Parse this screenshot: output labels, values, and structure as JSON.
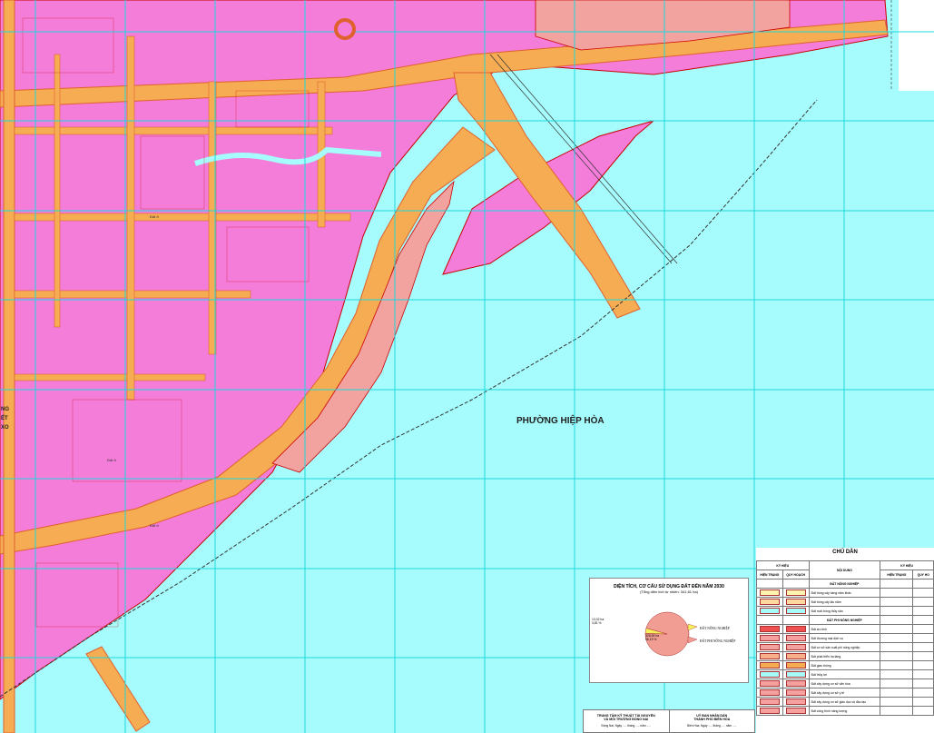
{
  "ward_label": "PHƯỜNG HIỆP HÒA",
  "edge_label_lines": [
    "NG",
    "ẾT",
    "XO"
  ],
  "block_labels": [
    "Đất ở",
    "Đất ở",
    "Đất ở"
  ],
  "colors": {
    "water": "#a6fcfc",
    "residential": "#f37dd9",
    "road": "#f6ac53",
    "road_edge": "#e0612d",
    "public": "#f2a3a0",
    "grid": "#1fd7de",
    "boundary": "#cc0000"
  },
  "pie": {
    "title": "DIỆN TÍCH, CƠ CẤU SỬ DỤNG ĐẤT ĐẾN NĂM 2030",
    "subtitle": "(Tổng diện tích tự nhiên: 341,61 ha)",
    "small_value": "13,02 ha",
    "small_pct": "3,81 %",
    "large_value": "328,59 ha",
    "large_pct": "96,19 %",
    "legend_1": "ĐẤT NÔNG NGHIỆP",
    "legend_2": "ĐẤT PHI NÔNG NGHIỆP"
  },
  "chart_data": {
    "type": "pie",
    "title": "DIỆN TÍCH, CƠ CẤU SỬ DỤNG ĐẤT ĐẾN NĂM 2030",
    "categories": [
      "ĐẤT NÔNG NGHIỆP",
      "ĐẤT PHI NÔNG NGHIỆP"
    ],
    "values": [
      13.02,
      328.59
    ],
    "percent": [
      3.81,
      96.19
    ],
    "colors": [
      "#f7f15a",
      "#f29d93"
    ]
  },
  "title_block": {
    "left_line1": "TRUNG TÂM KỸ THUẬT TÀI NGUYÊN",
    "left_line2": "VÀ MÔI TRƯỜNG ĐỒNG NAI",
    "left_sub": "Đồng Nai, Ngày ..... tháng ..... năm .....",
    "right_line1": "UỶ BAN NHÂN DÂN",
    "right_line2": "THÀNH PHỐ BIÊN HÒA",
    "right_sub": "Biên Hòa, Ngày ..... tháng ..... năm ....."
  },
  "legend": {
    "title": "CHỦ DẪN",
    "header_ky_hieu": "KÝ HIỆU",
    "header_noi_dung": "NỘI DUNG",
    "header_hien_trang": "HIỆN TRẠNG",
    "header_quy_hoach": "QUY HOẠCH",
    "header_quy_hoach_short": "QUY HO",
    "section_nn": "ĐẤT NÔNG NGHIỆP",
    "section_pnn": "ĐẤT PHI NÔNG NGHIỆP",
    "rows": [
      {
        "text": "Đất trồng cây hàng năm khác",
        "color": "#fff3b0"
      },
      {
        "text": "Đất trồng cây lâu năm",
        "color": "#ffd9a0"
      },
      {
        "text": "Đất nuôi trồng thủy sản",
        "color": "#a6fcfc"
      },
      {
        "text": "Đất an ninh",
        "color": "#f05050"
      },
      {
        "text": "Đất thương mại dịch vụ",
        "color": "#f7a0a0"
      },
      {
        "text": "Đất cơ sở sản xuất phi nông nghiệp",
        "color": "#f2a3a0"
      },
      {
        "text": "Đất phát triển hạ tầng",
        "color": "#f7b08a"
      },
      {
        "text": "Đất giao thông",
        "color": "#f6ac53"
      },
      {
        "text": "Đất thủy lợi",
        "color": "#a6fcfc"
      },
      {
        "text": "Đất xây dựng cơ sở văn hóa",
        "color": "#f7a0a0"
      },
      {
        "text": "Đất xây dựng cơ sở y tế",
        "color": "#f7a0a0"
      },
      {
        "text": "Đất xây dựng cơ sở giáo dục và đào tạo",
        "color": "#f7a0a0"
      },
      {
        "text": "Đất công trình năng lượng",
        "color": "#f7a0a0"
      }
    ]
  }
}
